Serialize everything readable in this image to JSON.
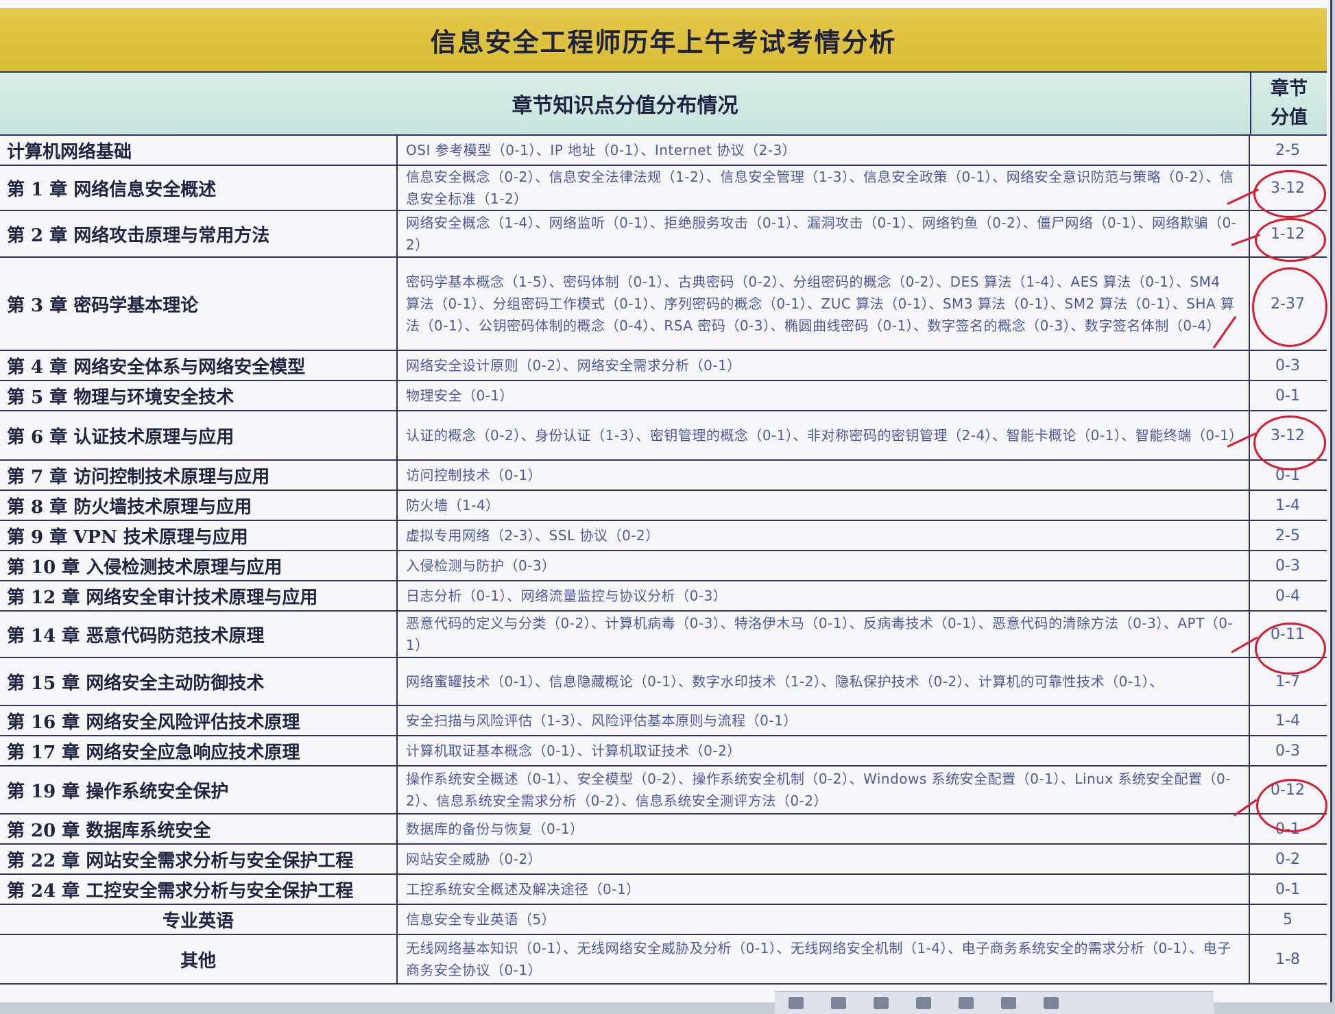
{
  "title": "信息安全工程师历年上午考试考情分析",
  "header": {
    "distribution": "章节知识点分值分布情况",
    "chapter_score_line1": "章节",
    "chapter_score_line2": "分值"
  },
  "rows": [
    {
      "chapter": "计算机网络基础",
      "points": "OSI 参考模型（0-1）、IP 地址（0-1）、Internet 协议（2-3）",
      "score": "2-5"
    },
    {
      "chapter": "第 1 章  网络信息安全概述",
      "points": "信息安全概念（0-2）、信息安全法律法规（1-2）、信息安全管理（1-3）、信息安全政策（0-1）、网络安全意识防范与策略（0-2）、信息安全标准（1-2）",
      "score": "3-12"
    },
    {
      "chapter": "第 2 章  网络攻击原理与常用方法",
      "points": "网络安全概念（1-4）、网络监听（0-1）、拒绝服务攻击（0-1）、漏洞攻击（0-1）、网络钓鱼（0-2）、僵尸网络（0-1）、网络欺骗（0-2）",
      "score": "1-12"
    },
    {
      "chapter": "第 3 章  密码学基本理论",
      "points": "密码学基本概念（1-5）、密码体制（0-1）、古典密码（0-2）、分组密码的概念（0-2）、DES 算法（1-4）、AES 算法（0-1）、SM4 算法（0-1）、分组密码工作模式（0-1）、序列密码的概念（0-1）、ZUC 算法（0-1）、SM3 算法（0-1）、SM2 算法（0-1）、SHA 算法（0-1）、公钥密码体制的概念（0-4）、RSA 密码（0-3）、椭圆曲线密码（0-1）、数字签名的概念（0-3）、数字签名体制（0-4）",
      "score": "2-37"
    },
    {
      "chapter": "第 4 章  网络安全体系与网络安全模型",
      "points": "网络安全设计原则（0-2）、网络安全需求分析（0-1）",
      "score": "0-3"
    },
    {
      "chapter": "第 5 章  物理与环境安全技术",
      "points": "物理安全（0-1）",
      "score": "0-1"
    },
    {
      "chapter": "第 6 章  认证技术原理与应用",
      "points": "认证的概念（0-2）、身份认证（1-3）、密钥管理的概念（0-1）、非对称密码的密钥管理（2-4）、智能卡概论（0-1）、智能终端（0-1）",
      "score": "3-12"
    },
    {
      "chapter": "第 7 章  访问控制技术原理与应用",
      "points": "访问控制技术（0-1）",
      "score": "0-1"
    },
    {
      "chapter": "第 8 章  防火墙技术原理与应用",
      "points": "防火墙（1-4）",
      "score": "1-4"
    },
    {
      "chapter": "第 9 章  VPN 技术原理与应用",
      "points": "虚拟专用网络（2-3）、SSL 协议（0-2）",
      "score": "2-5"
    },
    {
      "chapter": "第 10 章  入侵检测技术原理与应用",
      "points": "入侵检测与防护（0-3）",
      "score": "0-3"
    },
    {
      "chapter": "第 12 章  网络安全审计技术原理与应用",
      "points": "日志分析（0-1）、网络流量监控与协议分析（0-3）",
      "score": "0-4"
    },
    {
      "chapter": "第 14 章  恶意代码防范技术原理",
      "points": "恶意代码的定义与分类（0-2）、计算机病毒（0-3）、特洛伊木马（0-1）、反病毒技术（0-1）、恶意代码的清除方法（0-3）、APT（0-1）",
      "score": "0-11"
    },
    {
      "chapter": "第 15 章  网络安全主动防御技术",
      "points": "网络蜜罐技术（0-1）、信息隐藏概论（0-1）、数字水印技术（1-2）、隐私保护技术（0-2）、计算机的可靠性技术（0-1）、",
      "score": "1-7"
    },
    {
      "chapter": "第 16 章  网络安全风险评估技术原理",
      "points": "安全扫描与风险评估（1-3）、风险评估基本原则与流程（0-1）",
      "score": "1-4"
    },
    {
      "chapter": "第 17 章  网络安全应急响应技术原理",
      "points": "计算机取证基本概念（0-1）、计算机取证技术（0-2）",
      "score": "0-3"
    },
    {
      "chapter": "第 19 章  操作系统安全保护",
      "points": "操作系统安全概述（0-1）、安全模型（0-2）、操作系统安全机制（0-2）、Windows 系统安全配置（0-1）、Linux 系统安全配置（0-2）、信息系统安全需求分析（0-2）、信息系统安全测评方法（0-2）",
      "score": "0-12"
    },
    {
      "chapter": "第 20 章  数据库系统安全",
      "points": "数据库的备份与恢复（0-1）",
      "score": "0-1"
    },
    {
      "chapter": "第 22 章  网站安全需求分析与安全保护工程",
      "points": "网站安全威胁（0-2）",
      "score": "0-2"
    },
    {
      "chapter": "第 24 章  工控安全需求分析与安全保护工程",
      "points": "工控系统安全概述及解决途径（0-1）",
      "score": "0-1"
    },
    {
      "chapter": "专业英语",
      "points": "信息安全专业英语（5）",
      "score": "5"
    },
    {
      "chapter": "其他",
      "points": "无线网络基本知识（0-1）、无线网络安全威胁及分析（0-1）、无线网络安全机制（1-4）、电子商务系统安全的需求分析（0-1）、电子商务安全协议（0-1）",
      "score": "1-8"
    }
  ],
  "annotations": {
    "ink_color": "#e0182c",
    "circled_scores": [
      "3-12",
      "1-12",
      "2-37",
      "3-12",
      "0-11",
      "0-12"
    ]
  }
}
